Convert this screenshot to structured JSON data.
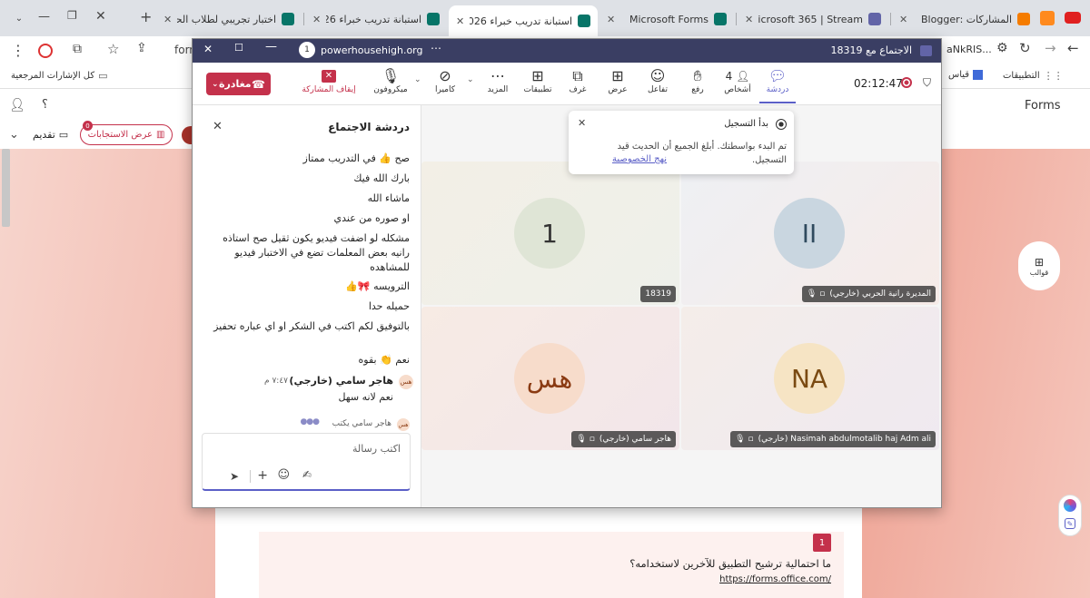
{
  "browser": {
    "tabs": [
      {
        "title": "المشاركات :Blogger",
        "fav_color": "#f57c00",
        "active": false
      },
      {
        "title": "Microsoft 365 | Stream",
        "fav_color": "#6264a7",
        "active": false
      },
      {
        "title": "Microsoft Forms",
        "fav_color": "#077568",
        "active": false
      },
      {
        "title": "استبانة تدريب خبراء 2026 ...",
        "fav_color": "#077568",
        "active": true
      },
      {
        "title": "استبانة تدريب خبراء 2026 ...",
        "fav_color": "#077568",
        "active": false
      },
      {
        "title": "اختبار تجريبي لطلاب الحاسـ...",
        "fav_color": "#077568",
        "active": false
      }
    ],
    "address_partial": "form",
    "extension_text": "aNkRIS...",
    "bookmarks": {
      "apps_label": "التطبيقات",
      "measure_label": "قياس",
      "all_bookmarks_label": "كل الإشارات المرجعية"
    }
  },
  "forms": {
    "brand": "Forms",
    "present_label": "تقديم",
    "view_responses_label": "عرض الاستجابات",
    "responses_badge": "0",
    "help_label": "؟",
    "templates_label": "قوالب",
    "question_number": "1",
    "question_text": "ما احتمالية ترشيح التطبيق للآخرين لاستخدامه؟",
    "question_link": "https://forms.office.com/"
  },
  "meeting": {
    "window_url": "powerhousehigh.org",
    "window_counter": "1",
    "window_title": "الاجتماع مع 18319",
    "timer": "02:12:47",
    "leave_label": "مغادرة",
    "controls": {
      "chat": "دردشة",
      "people": "أشخاص",
      "people_count": "4",
      "raise": "رفع",
      "react": "تفاعل",
      "view": "عرض",
      "rooms": "غرف",
      "apps": "تطبيقات",
      "more": "المزيد",
      "camera": "كاميرا",
      "mic": "ميكروفون",
      "stop_share": "إيقاف المشاركة"
    },
    "chat_panel": {
      "title": "دردشة الاجتماع",
      "messages": [
        "صح 👍 في التدريب ممتاز",
        "بارك الله فيك",
        "ماشاء الله",
        "او صوره من عندي",
        "مشكله لو اضفت فيديو يكون ثقيل صح استاذه رانيه بعض المعلمات تضع في الاختبار فيديو للمشاهده",
        "الترويسه 🎀👍",
        "حميله حدا",
        "بالتوفيق لكم اكتب في الشكر او اي عباره تحفيز",
        "نعم 👏 بقوه"
      ],
      "sender_initials": "هس",
      "sender_name": "هاجر سامي (خارجي)",
      "sender_time": "٧:٤٧ م",
      "sender_message": "نعم لانه سهل",
      "typing_text": "هاجر سامي يكتب",
      "compose_placeholder": "اكتب رسالة"
    },
    "recording_popup": {
      "title": "بدأ التسجيل",
      "body": "تم البدء بواسطتك. أبلغ الجميع أن الحديث قيد التسجيل.",
      "link": "نهج الخصوصية"
    },
    "participants": [
      {
        "initials": "II",
        "name": "المديرة رانية الحربي (خارجي)",
        "avatar_bg": "#c9d6e0",
        "avatar_color": "#2f4a5e"
      },
      {
        "initials": "1",
        "name": "18319",
        "avatar_bg": "#dfe5d6",
        "avatar_color": "#333333"
      },
      {
        "initials": "NA",
        "name": "Nasimah abdulmotalib haj Adm ali (خارجي)",
        "avatar_bg": "#f6e4c4",
        "avatar_color": "#7a4a12"
      },
      {
        "initials": "هس",
        "name": "هاجر سامي (خارجي)",
        "avatar_bg": "#f7dccb",
        "avatar_color": "#8a3a12"
      }
    ]
  },
  "colors": {
    "teams_title": "#3a3e63",
    "leave_red": "#c4314b",
    "forms_teal": "#077568",
    "accent_purple": "#5b5fc7"
  }
}
